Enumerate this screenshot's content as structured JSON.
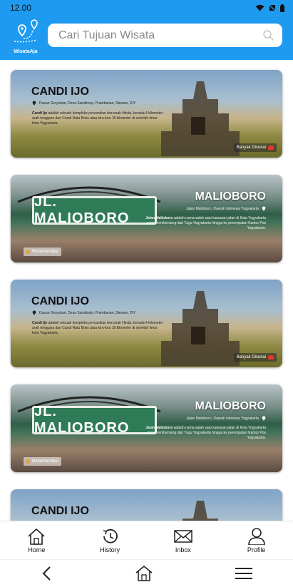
{
  "status": {
    "time": "12.00",
    "icons": [
      "wifi-icon",
      "signal-off-icon",
      "battery-icon"
    ]
  },
  "header": {
    "logo_text": "WisataAja",
    "search_placeholder": "Cari Tujuan Wisata"
  },
  "cards": [
    {
      "type": "candi",
      "title": "CANDI IJO",
      "location": "Dusun Groyokan, Desa Sambirejo, Prambanan, Sleman, DIY",
      "desc_bold": "Candi Ijo",
      "desc": " adalah sebuah kompleks percandian bercorak Hindu, berada 4 kilometer arah tenggara dari Candi Ratu Boko atau kira-kira 18 kilometer di sebelah timur kota Yogyakarta.",
      "badge": "Banyak Disukai"
    },
    {
      "type": "malio",
      "title": "MALIOBORO",
      "sign": "JL. MALIOBORO",
      "location": "Jalan Malioboro, Daerah Istimewa Yogyakarta",
      "desc_bold": "Jalan Malioboro",
      "desc": " adalah nama salah satu kawasan jalan di Kota Yogyakarta yang membentang dari Tugu Yogyakarta hingga ke perempatan Kantor Pos Yogyakarta.",
      "badge": "Rekomendasi"
    },
    {
      "type": "candi",
      "title": "CANDI IJO",
      "location": "Dusun Groyokan, Desa Sambirejo, Prambanan, Sleman, DIY",
      "desc_bold": "Candi Ijo",
      "desc": " adalah sebuah kompleks percandian bercorak Hindu, berada 4 kilometer arah tenggara dari Candi Ratu Boko atau kira-kira 18 kilometer di sebelah timur kota Yogyakarta.",
      "badge": "Banyak Disukai"
    },
    {
      "type": "malio",
      "title": "MALIOBORO",
      "sign": "JL. MALIOBORO",
      "location": "Jalan Malioboro, Daerah Istimewa Yogyakarta",
      "desc_bold": "Jalan Malioboro",
      "desc": " adalah nama salah satu kawasan jalan di Kota Yogyakarta yang membentang dari Tugu Yogyakarta hingga ke perempatan Kantor Pos Yogyakarta.",
      "badge": "Rekomendasi"
    },
    {
      "type": "candi",
      "title": "CANDI IJO",
      "location": "",
      "desc_bold": "",
      "desc": "",
      "badge": ""
    }
  ],
  "nav": {
    "home": "Home",
    "history": "History",
    "inbox": "Inbox",
    "profile": "Profile"
  },
  "colors": {
    "primary": "#1e9bf0",
    "heart": "#e33333",
    "sign_green": "#2f7a57"
  }
}
